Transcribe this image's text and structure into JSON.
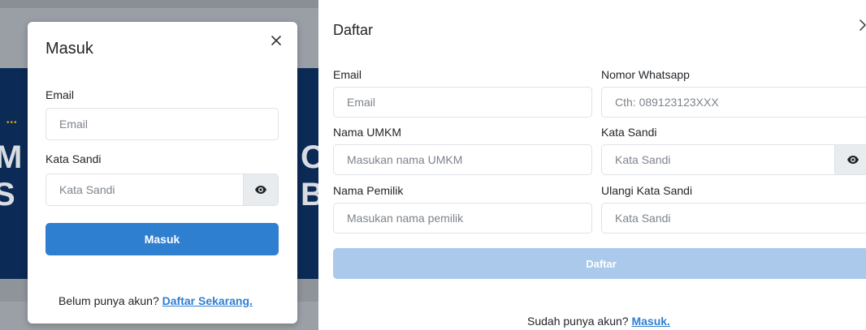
{
  "login": {
    "title": "Masuk",
    "email_label": "Email",
    "email_placeholder": "Email",
    "password_label": "Kata Sandi",
    "password_placeholder": "Kata Sandi",
    "submit_label": "Masuk",
    "footer_text": "Belum punya akun?",
    "footer_link": "Daftar Sekarang."
  },
  "register": {
    "title": "Daftar",
    "fields": {
      "email": {
        "label": "Email",
        "placeholder": "Email"
      },
      "whatsapp": {
        "label": "Nomor Whatsapp",
        "placeholder": "Cth: 089123123XXX"
      },
      "umkm": {
        "label": "Nama UMKM",
        "placeholder": "Masukan nama UMKM"
      },
      "password": {
        "label": "Kata Sandi",
        "placeholder": "Kata Sandi"
      },
      "owner": {
        "label": "Nama Pemilik",
        "placeholder": "Masukan nama pemilik"
      },
      "confirm_password": {
        "label": "Ulangi Kata Sandi",
        "placeholder": "Kata Sandi"
      }
    },
    "submit_label": "Daftar",
    "footer_text": "Sudah punya akun?",
    "footer_link": "Masuk."
  },
  "icons": {
    "close": "close-icon",
    "eye": "eye-icon"
  },
  "colors": {
    "primary": "#2f7fd1",
    "primary_disabled": "#aac9eb",
    "addon_bg": "#e9ecef",
    "backdrop_blue": "#0b2a55"
  }
}
